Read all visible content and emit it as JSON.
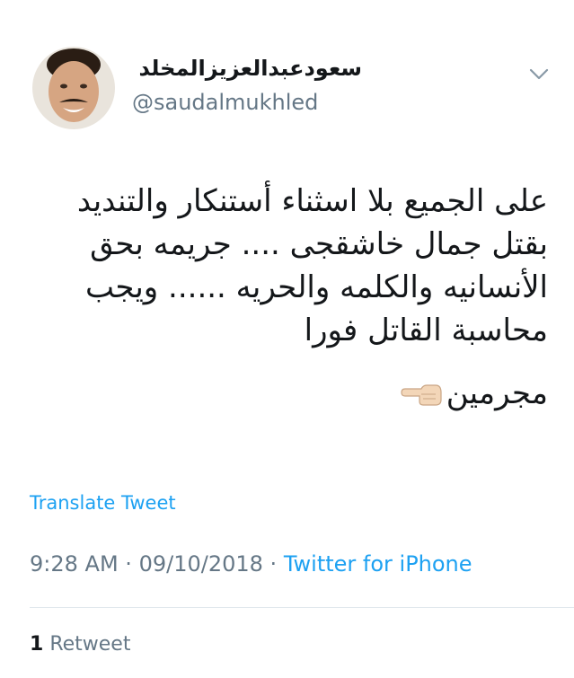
{
  "author": {
    "display_name": "سعودعبدالعزيزالمخلد",
    "handle": "@saudalmukhled"
  },
  "tweet": {
    "lines": [
      "على الجميع بلا اسثناء أستنكار والتنديد",
      "بقتل جمال خاشقجى .... جريمه بحق",
      "الأنسانيه والكلمه والحريه ...... ويجب",
      "محاسبة القاتل فورا"
    ],
    "emoji_line_text": "مجرمين",
    "emoji_icon": "pointing-left-hand-icon"
  },
  "translate_label": "Translate Tweet",
  "meta": {
    "time": "9:28 AM",
    "separator": "·",
    "date": "09/10/2018",
    "source": "Twitter for iPhone"
  },
  "stats": {
    "retweet_count": "1",
    "retweet_label": "Retweet"
  },
  "colors": {
    "link": "#1da1f2",
    "secondary_text": "#657786",
    "primary_text": "#14171a"
  }
}
